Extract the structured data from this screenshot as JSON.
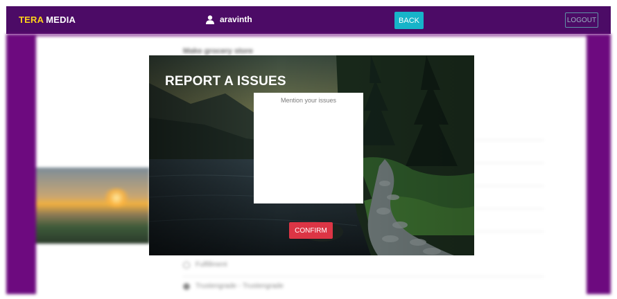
{
  "navbar": {
    "brand_part1": "TERA",
    "brand_part2": "MEDIA",
    "username": "aravinth",
    "back_label": "BACK",
    "logout_label": "LOGOUT",
    "colors": {
      "background": "#4c0b66",
      "brand_accent": "#ffd319",
      "back_button": "#17b4c9"
    }
  },
  "background_page": {
    "heading": "Make grocery store",
    "items": [
      {
        "icon": "outline-dot-icon",
        "label": "Fulfillment"
      },
      {
        "icon": "filled-dot-icon",
        "label": "Trustengrade - Trustengrade"
      }
    ]
  },
  "modal": {
    "title": "REPORT A ISSUES",
    "textarea_placeholder": "Mention your issues",
    "textarea_value": "",
    "confirm_label": "CONFIRM",
    "colors": {
      "confirm_button": "#dc3545"
    }
  }
}
